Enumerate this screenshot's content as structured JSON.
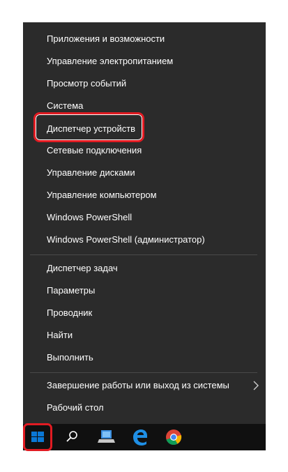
{
  "menu": {
    "group1": [
      {
        "label": "Приложения и возможности"
      },
      {
        "label": "Управление электропитанием"
      },
      {
        "label": "Просмотр событий"
      },
      {
        "label": "Система"
      },
      {
        "label": "Диспетчер устройств",
        "highlighted": true
      },
      {
        "label": "Сетевые подключения"
      },
      {
        "label": "Управление дисками"
      },
      {
        "label": "Управление компьютером"
      },
      {
        "label": "Windows PowerShell"
      },
      {
        "label": "Windows PowerShell (администратор)"
      }
    ],
    "group2": [
      {
        "label": "Диспетчер задач"
      },
      {
        "label": "Параметры"
      },
      {
        "label": "Проводник"
      },
      {
        "label": "Найти"
      },
      {
        "label": "Выполнить"
      }
    ],
    "group3": [
      {
        "label": "Завершение работы или выход из системы",
        "submenu": true
      },
      {
        "label": "Рабочий стол"
      }
    ]
  },
  "taskbar": {
    "icons": [
      "windows-start-icon",
      "search-icon",
      "computer-icon",
      "edge-icon",
      "chrome-icon"
    ]
  },
  "colors": {
    "menu_bg": "#2b2b2b",
    "taskbar_bg": "#101010",
    "highlight": "#e11b22",
    "windows_blue": "#0a78d7"
  }
}
